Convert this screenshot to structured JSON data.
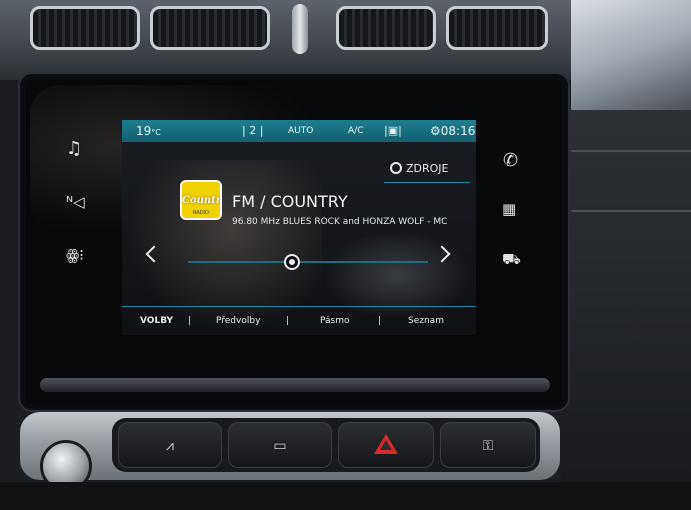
{
  "climate": {
    "temperature": "19",
    "temp_unit": "°C",
    "fan_level": "| 2 |",
    "auto_label": "AUTO",
    "ac_label": "A/C",
    "time": "08:16"
  },
  "header": {
    "source_label": "ZDROJE"
  },
  "station": {
    "logo_text": "Country",
    "logo_sub": "RADIO",
    "band_name": "FM / COUNTRY",
    "frequency_info": "96.80 MHz  BLUES ROCK and HONZA WOLF - MC"
  },
  "bottom_menu": {
    "options": "VOLBY",
    "presets": "Předvolby",
    "band": "Pásmo",
    "list": "Seznam",
    "separator": "|"
  },
  "side_icons": {
    "left": [
      "music-note-icon",
      "navigation-icon",
      "apps-icon"
    ],
    "right": [
      "phone-icon",
      "grid-icon",
      "car-icon"
    ]
  },
  "colors": {
    "accent": "#1d8aa0",
    "status_bar": "#13606f",
    "logo_yellow": "#f1d200",
    "hazard_red": "#d62a2a"
  }
}
